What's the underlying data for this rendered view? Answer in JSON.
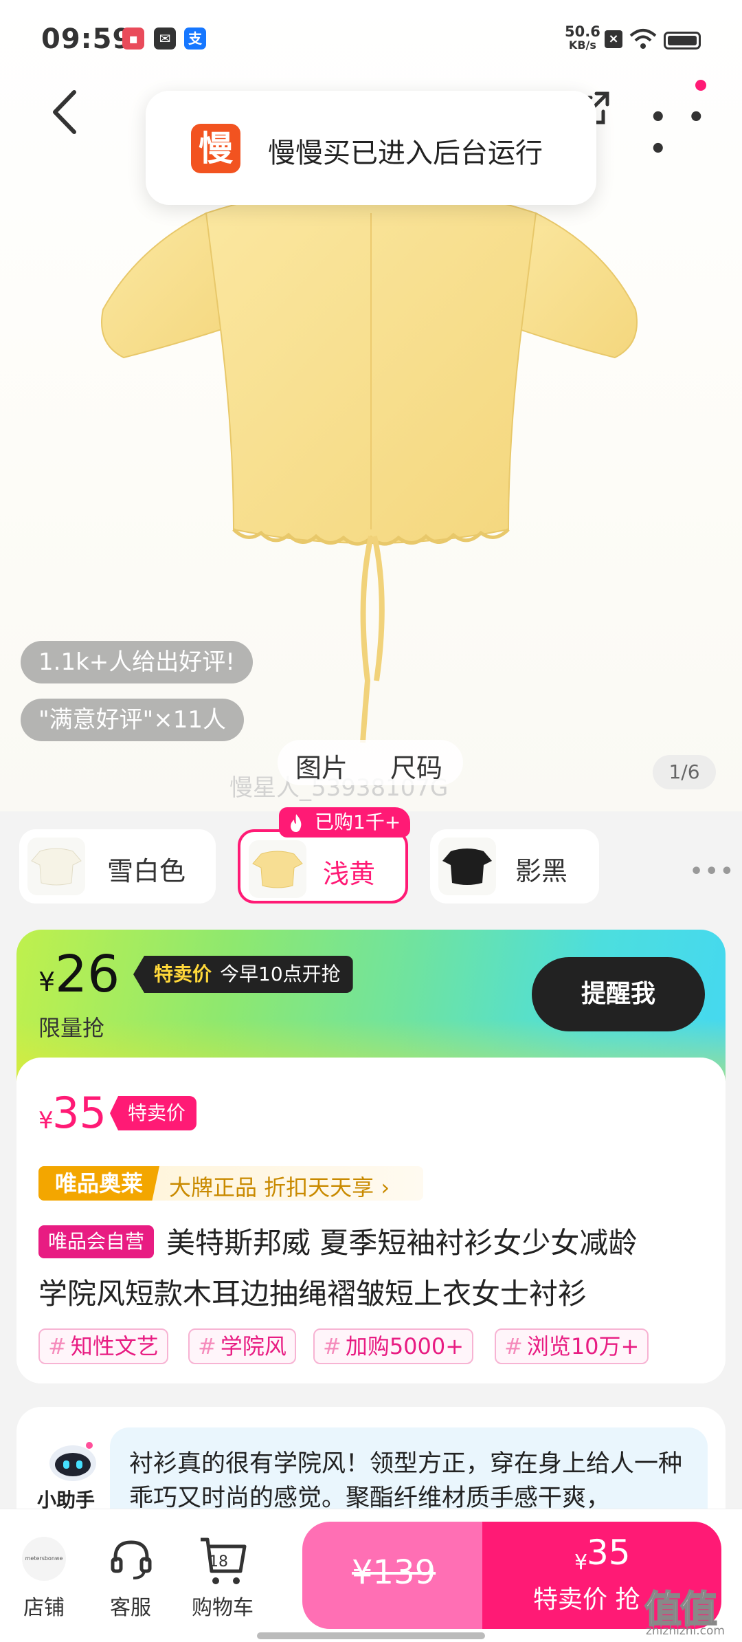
{
  "status_bar": {
    "time": "09:59",
    "speed_value": "50.6",
    "speed_unit": "KB/s"
  },
  "toast": {
    "logo_char": "慢",
    "text": "慢慢买已进入后台运行"
  },
  "hero": {
    "pill_reviews": "1.1k+人给出好评!",
    "pill_satisfied": "\"满意好评\"×11人",
    "tab_images": "图片",
    "tab_size": "尺码",
    "watermark": "慢星人_53938107G",
    "pager": "1/6"
  },
  "variants": [
    {
      "label": "雪白色",
      "selected": false
    },
    {
      "label": "浅黄",
      "selected": true,
      "badge": "已购1千+"
    },
    {
      "label": "影黑",
      "selected": false
    }
  ],
  "flash_sale": {
    "currency": "¥",
    "price": "26",
    "tag_label": "特卖价",
    "tag_text": "今早10点开抢",
    "limit_text": "限量抢",
    "remind_button": "提醒我"
  },
  "special_price": {
    "currency": "¥",
    "price": "35",
    "tag": "特卖价"
  },
  "outlet": {
    "brand": "唯品奥莱",
    "text": "大牌正品 折扣天天享 ›"
  },
  "product": {
    "self_tag": "唯品会自营",
    "title_line1": "美特斯邦威 夏季短袖衬衫女少女减龄",
    "title_line2": "学院风短款木耳边抽绳褶皱短上衣女士衬衫",
    "chips": [
      "知性文艺",
      "学院风",
      "加购5000+",
      "浏览10万+"
    ]
  },
  "assistant": {
    "label": "小助手",
    "text": "衬衫真的很有学院风！领型方正，穿在身上给人一种乖巧又时尚的感觉。聚酯纤维材质手感干爽，"
  },
  "bottom_bar": {
    "shop_label": "店铺",
    "shop_logo_text": "metersbonwe",
    "service_label": "客服",
    "cart_label": "购物车",
    "cart_count": "18",
    "original_price": "¥139",
    "buy_currency": "¥",
    "buy_price": "35",
    "buy_label": "特卖价 抢"
  },
  "corner_watermark": {
    "logo": "值值值",
    "url": "zhizhizhi.com"
  },
  "colors": {
    "accent": "#ff1a75",
    "outlet": "#f3a600",
    "app_logo": "#f25320"
  }
}
